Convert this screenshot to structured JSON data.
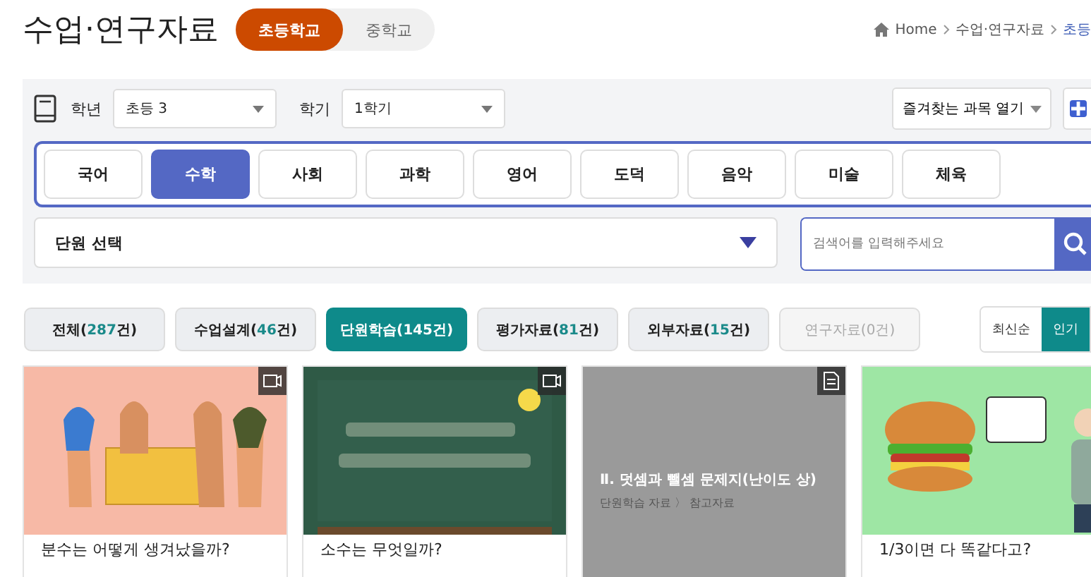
{
  "header": {
    "title": "수업·연구자료",
    "school_tabs": [
      {
        "label": "초등학교",
        "selected": true
      },
      {
        "label": "중학교",
        "selected": false
      }
    ],
    "breadcrumb": [
      {
        "label": "Home",
        "current": false
      },
      {
        "label": "수업·연구자료",
        "current": false
      },
      {
        "label": "초등",
        "current": true
      }
    ]
  },
  "filters": {
    "grade_label": "학년",
    "grade_value": "초등 3",
    "term_label": "학기",
    "term_value": "1학기",
    "favorites_button": "즐겨찾는 과목 열기"
  },
  "subjects": [
    {
      "label": "국어",
      "selected": false
    },
    {
      "label": "수학",
      "selected": true
    },
    {
      "label": "사회",
      "selected": false
    },
    {
      "label": "과학",
      "selected": false
    },
    {
      "label": "영어",
      "selected": false
    },
    {
      "label": "도덕",
      "selected": false
    },
    {
      "label": "음악",
      "selected": false
    },
    {
      "label": "미술",
      "selected": false
    },
    {
      "label": "체육",
      "selected": false
    }
  ],
  "unit_select": {
    "value": "단원 선택"
  },
  "search": {
    "placeholder": "검색어를 입력해주세요"
  },
  "categories": [
    {
      "name": "전체(",
      "count": "287",
      "tail": "건)",
      "selected": false,
      "disabled": false
    },
    {
      "name": "수업설계(",
      "count": "46",
      "tail": "건)",
      "selected": false,
      "disabled": false
    },
    {
      "name": "단원학습(",
      "count": "145",
      "tail": "건)",
      "selected": true,
      "disabled": false
    },
    {
      "name": "평가자료(",
      "count": "81",
      "tail": "건)",
      "selected": false,
      "disabled": false
    },
    {
      "name": "외부자료(",
      "count": "15",
      "tail": "건)",
      "selected": false,
      "disabled": false
    },
    {
      "name": "연구자료(",
      "count": "0",
      "tail": "건)",
      "selected": false,
      "disabled": true
    }
  ],
  "sort": [
    {
      "label": "최신순",
      "selected": false
    },
    {
      "label": "인기",
      "selected": true
    }
  ],
  "cards": [
    {
      "kind": "video",
      "title": "분수는 어떻게 생겨났을까?"
    },
    {
      "kind": "video",
      "title": "소수는 무엇일까?"
    },
    {
      "kind": "document",
      "overlay_title": "Ⅱ. 덧셈과 뺄셈 문제지(난이도 상)",
      "overlay_path": "단원학습 자료 〉 참고자료"
    },
    {
      "kind": "plain",
      "title": "1/3이면 다 똑같다고?"
    }
  ]
}
